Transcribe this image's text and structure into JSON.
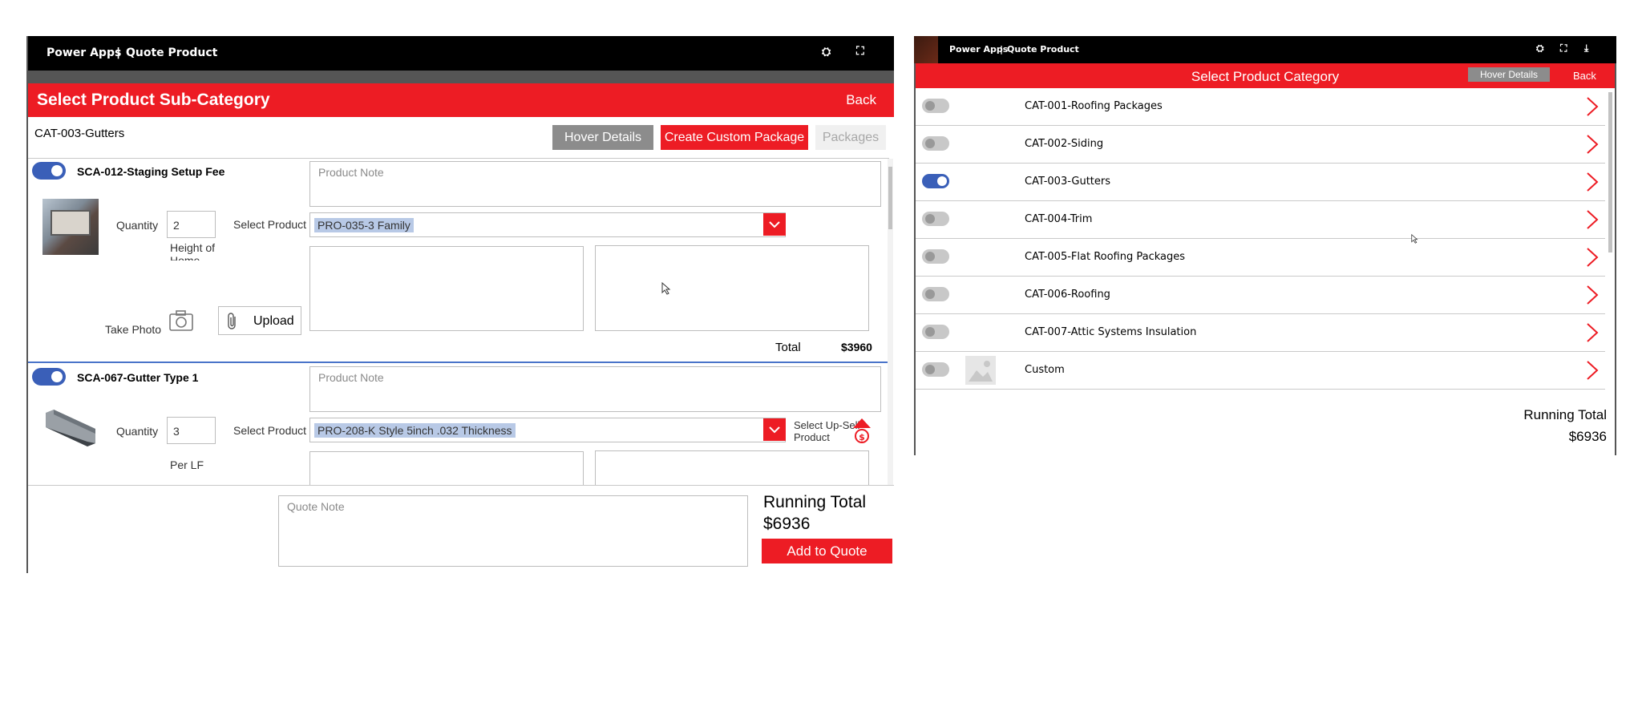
{
  "left": {
    "titlebar": {
      "app": "Power Apps",
      "sep": "|",
      "screen": "Quote Product"
    },
    "header": {
      "title": "Select Product Sub-Category",
      "back": "Back"
    },
    "category": "CAT-003-Gutters",
    "buttons": {
      "hover": "Hover Details",
      "custom": "Create Custom Package",
      "packages": "Packages"
    },
    "items": [
      {
        "name": "SCA-012-Staging Setup Fee",
        "note_placeholder": "Product Note",
        "quantity_label": "Quantity",
        "quantity": "2",
        "unit": "Height of Home",
        "select_label": "Select Product",
        "product": "PRO-035-3 Family",
        "take_photo": "Take Photo",
        "upload": "Upload",
        "total_label": "Total",
        "total_value": "$3960"
      },
      {
        "name": "SCA-067-Gutter Type 1",
        "note_placeholder": "Product Note",
        "quantity_label": "Quantity",
        "quantity": "3",
        "unit": "Per LF",
        "select_label": "Select Product",
        "product": "PRO-208-K Style 5inch .032 Thickness",
        "upsell": "Select Up-Sell Product"
      }
    ],
    "footer": {
      "quote_note_placeholder": "Quote Note",
      "running_total_label": "Running Total",
      "running_total_value": "$6936",
      "add_to_quote": "Add to Quote"
    }
  },
  "right": {
    "titlebar": {
      "app": "Power Apps",
      "sep": "|",
      "screen": "Quote Product"
    },
    "header": {
      "title": "Select Product Category",
      "hover": "Hover Details",
      "back": "Back"
    },
    "categories": [
      {
        "name": "CAT-001-Roofing Packages",
        "on": false
      },
      {
        "name": "CAT-002-Siding",
        "on": false
      },
      {
        "name": "CAT-003-Gutters",
        "on": true
      },
      {
        "name": "CAT-004-Trim",
        "on": false
      },
      {
        "name": "CAT-005-Flat Roofing Packages",
        "on": false
      },
      {
        "name": "CAT-006-Roofing",
        "on": false
      },
      {
        "name": "CAT-007-Attic Systems Insulation",
        "on": false
      },
      {
        "name": "Custom",
        "on": false
      }
    ],
    "running_total_label": "Running Total",
    "running_total_value": "$6936"
  },
  "colors": {
    "accent": "#ed1c24",
    "toggle_on": "#3a5fb8",
    "disabled_btn": "#8c8c8c"
  },
  "icons": [
    "camera-icon",
    "paperclip-icon",
    "chevron-down-icon",
    "chevron-right-icon",
    "upsell-icon",
    "image-placeholder-icon",
    "cursor-icon",
    "fullscreen-icon",
    "download-icon"
  ]
}
